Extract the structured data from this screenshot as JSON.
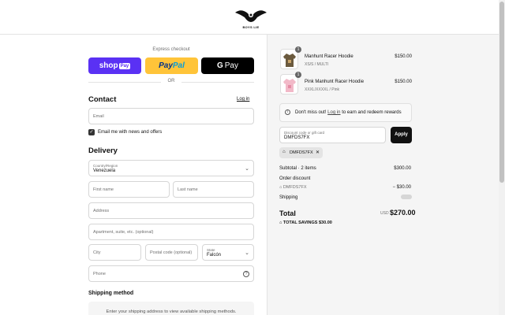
{
  "brand": {
    "logo_text": "BOYS LIE"
  },
  "express": {
    "title": "Express checkout",
    "shop_pay": {
      "shop": "shop",
      "pay": "Pay"
    },
    "paypal": {
      "pay": "Pay",
      "pal": "Pal"
    },
    "gpay": {
      "g": "G",
      "pay": "Pay"
    },
    "or": "OR"
  },
  "contact": {
    "title": "Contact",
    "login": "Log in",
    "email_placeholder": "Email",
    "newsletter_label": "Email me with news and offers",
    "newsletter_checked": true
  },
  "delivery": {
    "title": "Delivery",
    "country_label": "Country/Region",
    "country_value": "Venezuela",
    "first_name": "First name",
    "last_name": "Last name",
    "address": "Address",
    "apartment": "Apartment, suite, etc. (optional)",
    "city": "City",
    "postal": "Postal code (optional)",
    "state_label": "State",
    "state_value": "Falcón",
    "phone": "Phone"
  },
  "shipping_method": {
    "title": "Shipping method",
    "notice": "Enter your shipping address to view available shipping methods."
  },
  "cart": {
    "items": [
      {
        "name": "Manhunt Racer Hoodie",
        "variant": "XS/S / MULTI",
        "price": "$150.00",
        "qty": "1",
        "color": "#6b5a3e"
      },
      {
        "name": "Pink Manhunt Racer Hoodie",
        "variant": "XXXL/XXXXL / Pink",
        "price": "$150.00",
        "qty": "1",
        "color": "#f2b9c8"
      }
    ],
    "rewards": {
      "prefix": "Don't miss out!",
      "link": "Log in",
      "suffix": "to earn and redeem rewards"
    },
    "discount": {
      "label": "Discount code or gift card",
      "value": "DMFDS7FX",
      "apply": "Apply"
    },
    "chip_code": "DMFDS7FX",
    "subtotal_label": "Subtotal · 2 items",
    "subtotal_value": "$300.00",
    "order_discount_label": "Order discount",
    "order_discount_code": "DMFDS7FX",
    "order_discount_value": "− $30.00",
    "shipping_label": "Shipping",
    "total_label": "Total",
    "currency": "USD",
    "total_value": "$270.00",
    "savings_label": "TOTAL SAVINGS",
    "savings_value": "$30.00"
  }
}
